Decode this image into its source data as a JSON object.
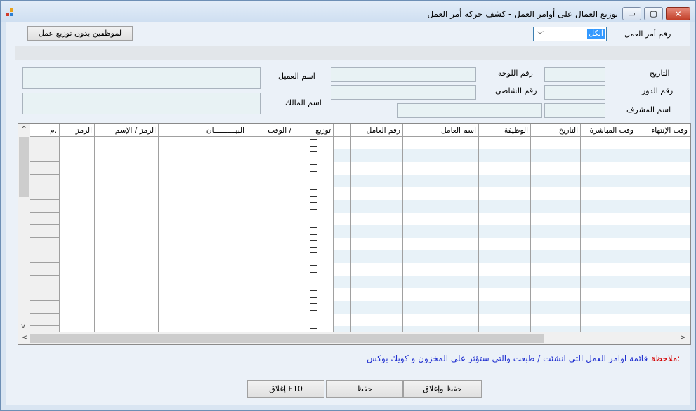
{
  "window": {
    "title": "توزيع العمال على أوامر العمل - كشف حركة أمر العمل",
    "buttons": {
      "minimize": "▭",
      "maximize": "▢",
      "close": "✕"
    }
  },
  "header": {
    "no_assign_button": "لموظفين بدون توزيع عمل",
    "order_label": "رقم أمر العمل",
    "order_value": "الكل"
  },
  "info": {
    "date_label": "التاريخ",
    "turn_label": "رقم الدور",
    "supervisor_label": "اسم المشرف",
    "plate_label": "رقم اللوحة",
    "chassis_label": "رقم الشاصي",
    "customer_label": "اسم العميل",
    "owner_label": "اسم المالك"
  },
  "grid": {
    "columns": [
      "وقت الإنتهاء",
      "وقت المباشرة",
      "التاريخ",
      "الوظيفة",
      "اسم العامل",
      "رقم العامل",
      "",
      "توزيع",
      "الوقت /",
      "البيــــــــــان",
      "الرمز / الإسم",
      "الرمز",
      "م."
    ],
    "row_count": 16,
    "scroll_up": "^",
    "scroll_down": "v",
    "scroll_left": "<",
    "scroll_right": ">"
  },
  "note": {
    "label": "ملاحظة:",
    "text": "قائمة  اوامر العمل التي انشئت / طبعت والتي ستؤثر على المخزون و كويك بوكس"
  },
  "footer": {
    "save_close": "حفظ وإغلاق",
    "save": "حفظ",
    "close": "إغلاق F10"
  }
}
